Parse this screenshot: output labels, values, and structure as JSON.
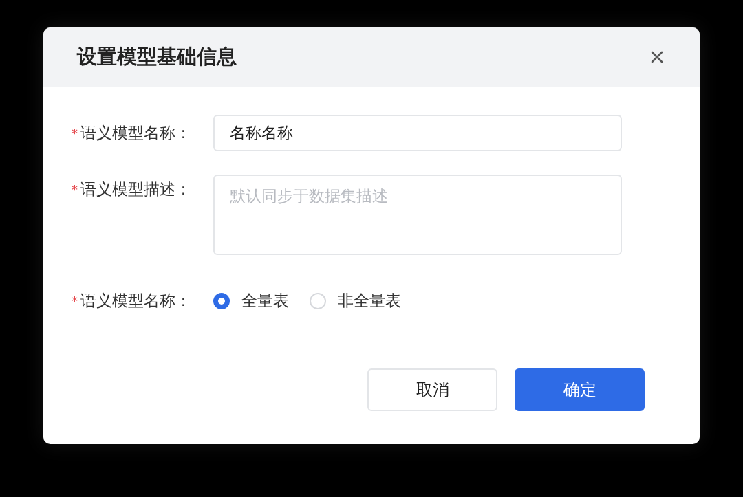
{
  "dialog": {
    "title": "设置模型基础信息",
    "fields": [
      {
        "kind": "input",
        "required_mark": "*",
        "label": "语义模型名称：",
        "value": "名称名称"
      },
      {
        "kind": "textarea",
        "required_mark": "*",
        "label": "语义模型描述：",
        "placeholder": "默认同步于数据集描述"
      },
      {
        "kind": "radio",
        "required_mark": "*",
        "label": "语义模型名称：",
        "options": [
          {
            "label": "全量表",
            "selected": true
          },
          {
            "label": "非全量表",
            "selected": false
          }
        ]
      }
    ],
    "buttons": [
      {
        "label": "取消",
        "kind": "secondary"
      },
      {
        "label": "确定",
        "kind": "primary"
      }
    ]
  }
}
